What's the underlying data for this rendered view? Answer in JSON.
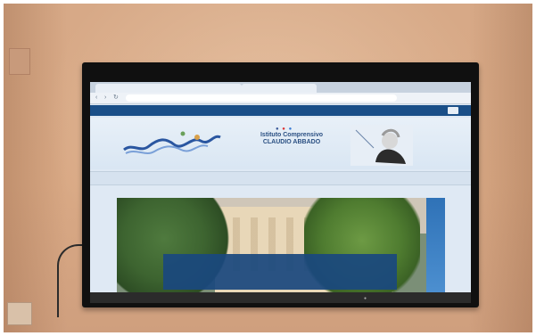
{
  "scene": {
    "description_tags": [
      "photo",
      "television",
      "wall"
    ],
    "colors": {
      "wall": "#d7a987",
      "tv_frame": "#101010",
      "site_blue": "#1a4f88",
      "cookie_bg": "#1a487e"
    }
  },
  "browser": {
    "tab1_label": "",
    "tab2_label": "",
    "url": "",
    "notice_text": "",
    "notice_button": ""
  },
  "site": {
    "title_line1": "Istituto Comprensivo",
    "title_line2": "CLAUDIO ABBADO",
    "subtitle": "",
    "menu": [
      "",
      "",
      "",
      "",
      "",
      "",
      "",
      ""
    ]
  },
  "cookie_banner": {
    "text": "",
    "links": [
      "",
      "",
      ""
    ]
  }
}
